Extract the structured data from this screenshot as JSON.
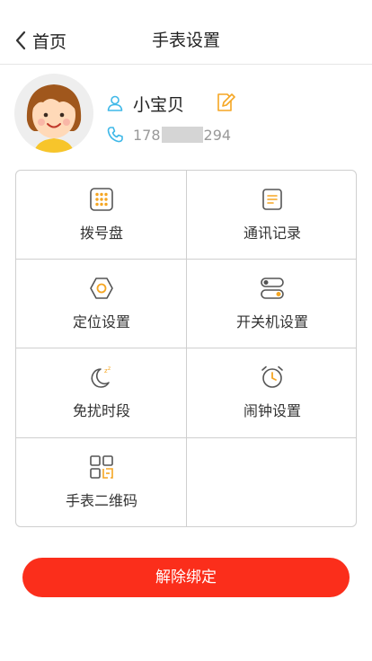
{
  "header": {
    "back_label": "首页",
    "title": "手表设置"
  },
  "profile": {
    "name": "小宝贝",
    "phone_prefix": "178",
    "phone_suffix": "294"
  },
  "menu": [
    {
      "label": "拨号盘",
      "icon": "dialpad-icon"
    },
    {
      "label": "通讯记录",
      "icon": "contact-log-icon"
    },
    {
      "label": "定位设置",
      "icon": "location-icon"
    },
    {
      "label": "开关机设置",
      "icon": "power-toggle-icon"
    },
    {
      "label": "免扰时段",
      "icon": "do-not-disturb-moon-icon"
    },
    {
      "label": "闹钟设置",
      "icon": "alarm-clock-icon"
    },
    {
      "label": "手表二维码",
      "icon": "qr-code-icon"
    }
  ],
  "actions": {
    "unbind_label": "解除绑定"
  },
  "colors": {
    "accent": "#F5A623",
    "icon_blue": "#3FB8E8",
    "danger": "#FB2E1B"
  }
}
